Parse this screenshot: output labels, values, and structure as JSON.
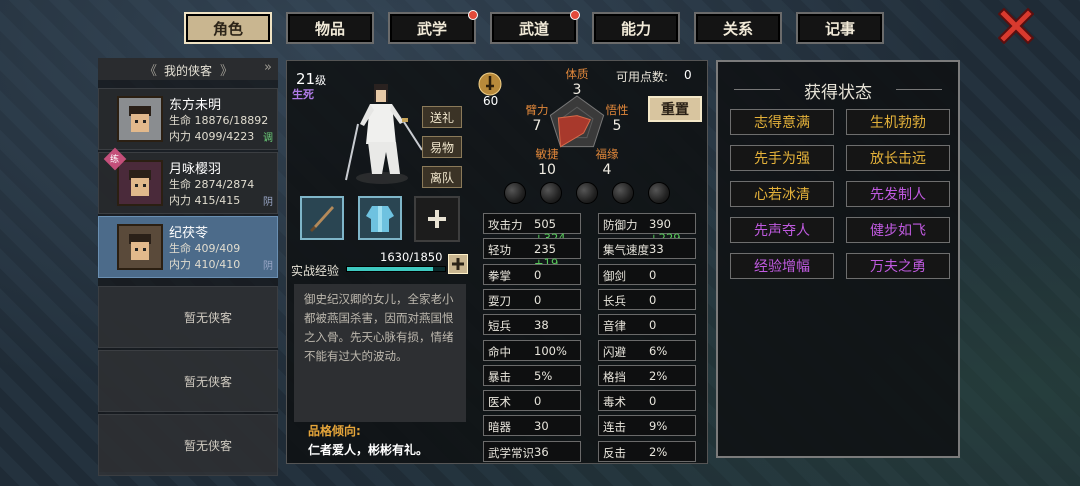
{
  "tabs": [
    {
      "label": "角色",
      "active": true,
      "badge": false
    },
    {
      "label": "物品",
      "active": false,
      "badge": false
    },
    {
      "label": "武学",
      "active": false,
      "badge": true
    },
    {
      "label": "武道",
      "active": false,
      "badge": true
    },
    {
      "label": "能力",
      "active": false,
      "badge": false
    },
    {
      "label": "关系",
      "active": false,
      "badge": false
    },
    {
      "label": "记事",
      "active": false,
      "badge": false
    }
  ],
  "companions": {
    "header": "我的侠客",
    "slots": [
      {
        "name": "东方未明",
        "hp": "生命 18876/18892",
        "mp": "内力 4099/4223",
        "tag": "调",
        "tag_color": "#6dd17a"
      },
      {
        "name": "月咏樱羽",
        "hp": "生命 2874/2874",
        "mp": "内力 415/415",
        "tag": "阴",
        "tag_color": "#9aa7c7",
        "corner": "练"
      },
      {
        "name": "纪茯苓",
        "hp": "生命 409/409",
        "mp": "内力 410/410",
        "tag": "阴",
        "tag_color": "#9aa7c7"
      }
    ],
    "empty_label": "暂无侠客",
    "empty_count": 3
  },
  "character": {
    "level": "21",
    "level_unit": "级",
    "status": "生死",
    "buttons": {
      "gift": "送礼",
      "trade": "易物",
      "leave": "离队"
    },
    "exp_label": "实战经验",
    "exp_text": "1630/1850",
    "exp_fraction": 0.881,
    "description": "御史纪汉卿的女儿，全家老小都被燕国杀害，因而对燕国恨之入骨。先天心脉有损，情绪不能有过大的波动。",
    "trait_title": "品格倾向:",
    "trait_text": "仁者爱人，彬彬有礼。"
  },
  "attributes": {
    "sword_icon_value": "60",
    "points_label": "可用点数:",
    "points_value": "0",
    "reset_label": "重置",
    "radar": [
      {
        "label": "体质",
        "value": "3"
      },
      {
        "label": "悟性",
        "value": "5"
      },
      {
        "label": "福缘",
        "value": "4"
      },
      {
        "label": "敏捷",
        "value": "10"
      },
      {
        "label": "臂力",
        "value": "7"
      }
    ]
  },
  "stats": [
    {
      "k": "攻击力",
      "v": "505",
      "b": "+324"
    },
    {
      "k": "防御力",
      "v": "390",
      "b": "+229"
    },
    {
      "k": "轻功",
      "v": "235",
      "b": "+19"
    },
    {
      "k": "集气速度",
      "v": "33",
      "b": ""
    },
    {
      "k": "拳掌",
      "v": "0",
      "b": ""
    },
    {
      "k": "御剑",
      "v": "0",
      "b": ""
    },
    {
      "k": "耍刀",
      "v": "0",
      "b": ""
    },
    {
      "k": "长兵",
      "v": "0",
      "b": ""
    },
    {
      "k": "短兵",
      "v": "38",
      "b": ""
    },
    {
      "k": "音律",
      "v": "0",
      "b": ""
    },
    {
      "k": "命中",
      "v": "100%",
      "b": ""
    },
    {
      "k": "闪避",
      "v": "6%",
      "b": ""
    },
    {
      "k": "暴击",
      "v": "5%",
      "b": ""
    },
    {
      "k": "格挡",
      "v": "2%",
      "b": ""
    },
    {
      "k": "医术",
      "v": "0",
      "b": ""
    },
    {
      "k": "毒术",
      "v": "0",
      "b": ""
    },
    {
      "k": "暗器",
      "v": "30",
      "b": ""
    },
    {
      "k": "连击",
      "v": "9%",
      "b": ""
    },
    {
      "k": "武学常识",
      "v": "36",
      "b": ""
    },
    {
      "k": "反击",
      "v": "2%",
      "b": ""
    }
  ],
  "buffs": {
    "title": "获得状态",
    "items": [
      {
        "label": "志得意满",
        "color": "#e5b23a"
      },
      {
        "label": "生机勃勃",
        "color": "#e5b23a"
      },
      {
        "label": "先手为强",
        "color": "#e5b23a"
      },
      {
        "label": "放长击远",
        "color": "#e5b23a"
      },
      {
        "label": "心若冰清",
        "color": "#e5b23a"
      },
      {
        "label": "先发制人",
        "color": "#c05ae0"
      },
      {
        "label": "先声夺人",
        "color": "#c05ae0"
      },
      {
        "label": "健步如飞",
        "color": "#c05ae0"
      },
      {
        "label": "经验增幅",
        "color": "#c05ae0"
      },
      {
        "label": "万夫之勇",
        "color": "#c05ae0"
      }
    ]
  }
}
